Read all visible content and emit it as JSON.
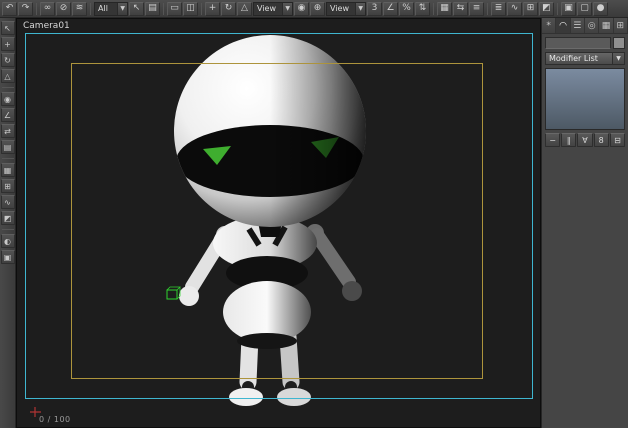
{
  "colors": {
    "safe_frame_outer": "#3fb6d0",
    "safe_frame_inner": "#ad943c",
    "eye_green": "#3fae2f",
    "helper_green": "#2fd32f",
    "viewport_bg": "#1d1d1d",
    "modifier_stack_bg": "#6b7c90"
  },
  "toolbar": {
    "icons": {
      "undo": "↶",
      "redo": "↷",
      "select_link": "∞",
      "unlink": "⊘",
      "bind_spacewarp": "≋",
      "select_object": "↖",
      "select_by_name": "▤",
      "selection_region": "▭",
      "window_crossing": "◫",
      "select_move": "+",
      "select_rotate": "↻",
      "select_scale": "△",
      "use_center": "◉",
      "select_manipulate": "⊕",
      "snap_toggle": "3",
      "angle_snap": "∠",
      "percent_snap": "%",
      "spinner_snap": "⇅",
      "named_selections": "▦",
      "mirror": "⇆",
      "align": "≡",
      "layer_manager": "≣",
      "curve_editor": "∿",
      "schematic_view": "⊞",
      "material_editor": "◩",
      "render_setup": "▣",
      "render_frame": "▢",
      "quick_render": "●"
    },
    "filter_dropdown": {
      "value": "All",
      "arrow": "▼"
    },
    "coord_dropdown": {
      "value": "View",
      "arrow": "▼"
    },
    "coord_dropdown_2": {
      "value": "View",
      "arrow": "▼"
    }
  },
  "left_toolbar": {
    "icons": [
      "↖",
      "+",
      "↻",
      "△",
      "◉",
      "∠",
      "⇄",
      "▤",
      "▦",
      "⊞",
      "∿",
      "◩",
      "◐",
      "▣"
    ]
  },
  "viewport": {
    "camera_label": "Camera01",
    "frame_counter": "0 / 100"
  },
  "right_panel": {
    "tabs": {
      "create": "*",
      "modify": "◠",
      "hierarchy": "☰",
      "motion": "◎",
      "display": "▦",
      "utilities": "⊞"
    },
    "object_name": "",
    "modifier_list": {
      "label": "Modifier List",
      "arrow": "▼"
    },
    "stack_buttons": {
      "pin_stack": "−",
      "show_end_result": "∥",
      "make_unique": "∀",
      "remove_modifier": "8",
      "configure_sets": "⊟"
    }
  }
}
